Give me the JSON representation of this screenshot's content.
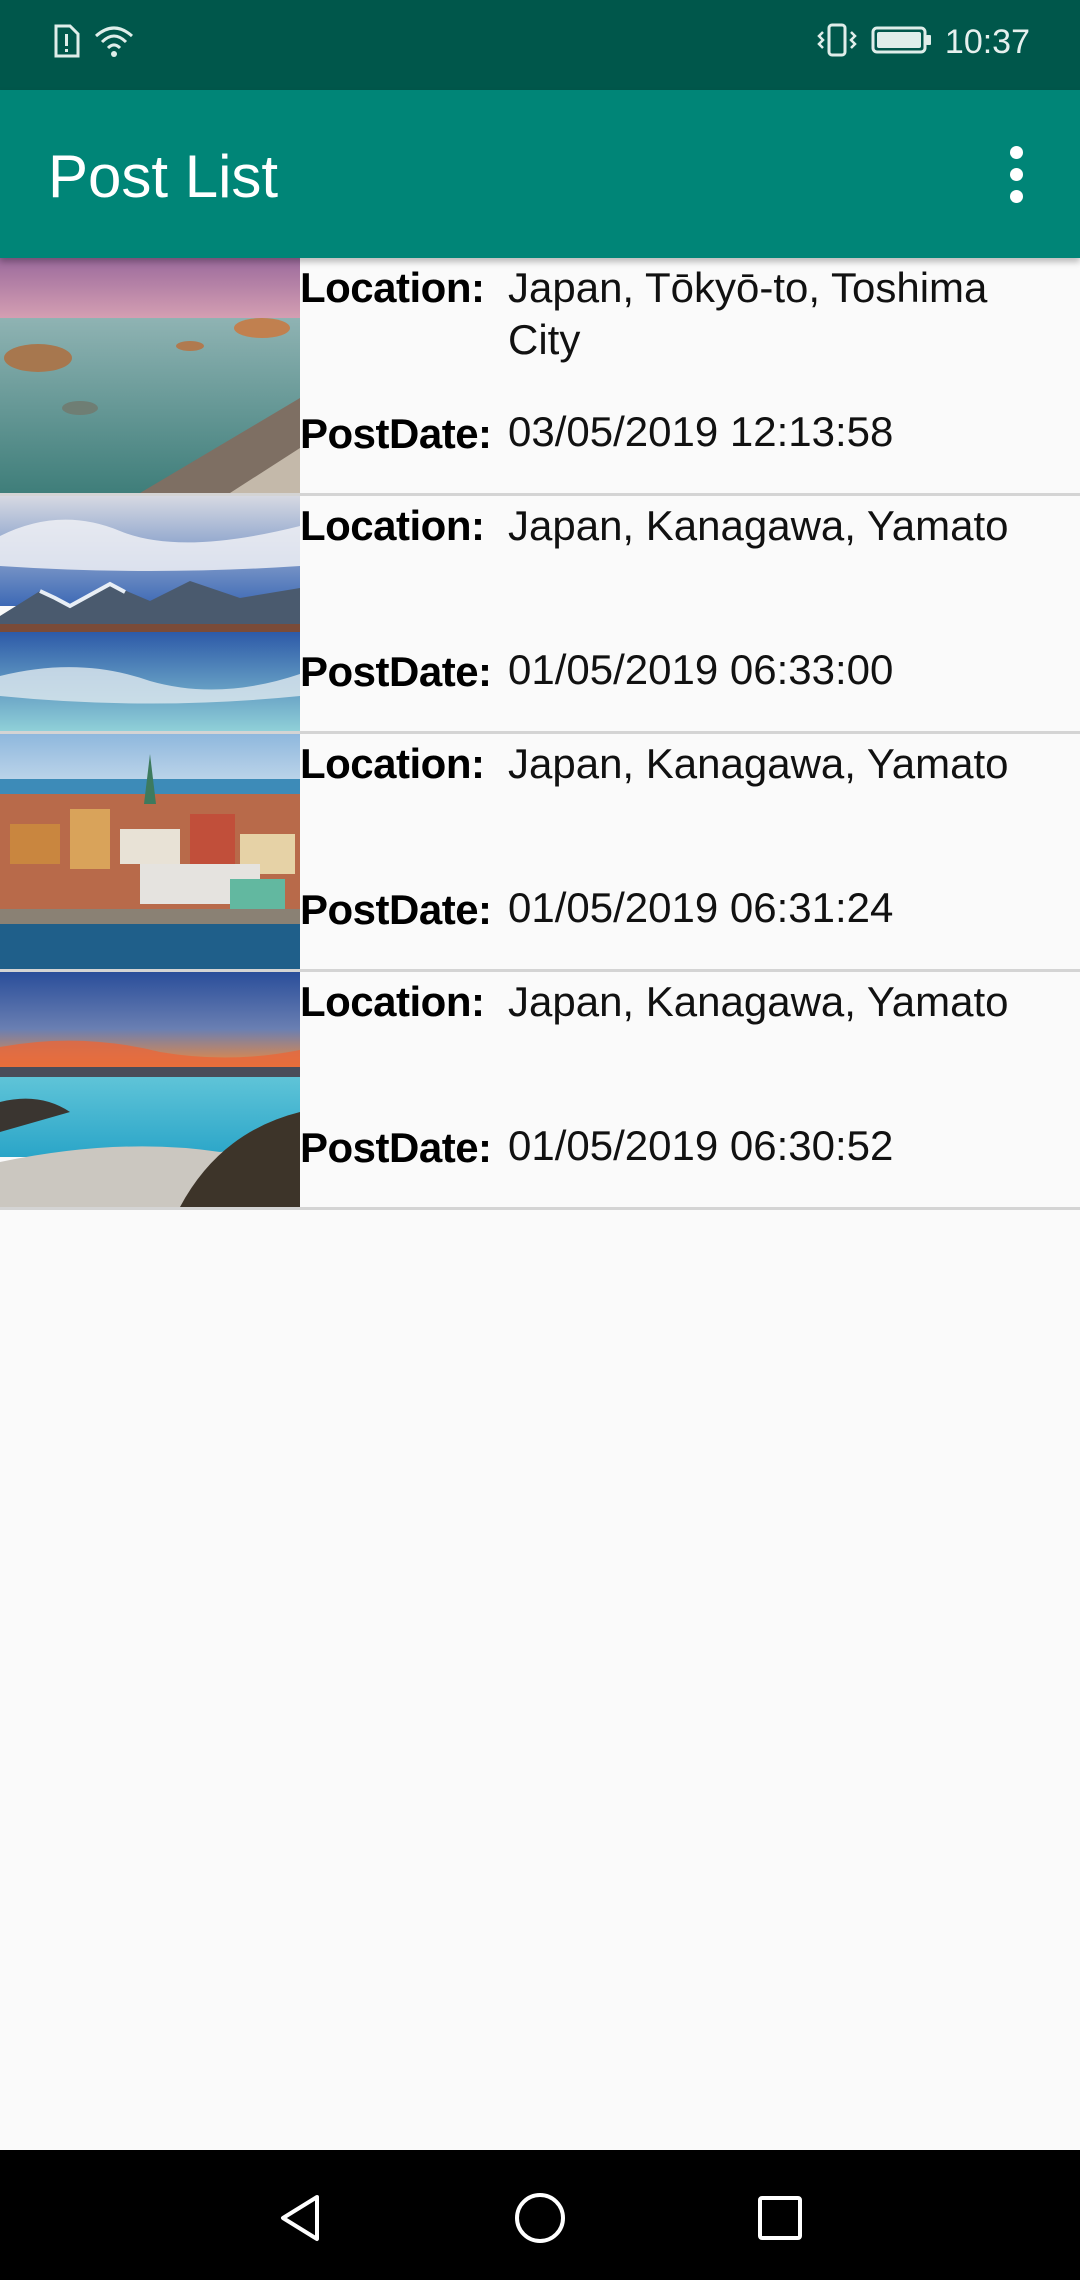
{
  "status_bar": {
    "time": "10:37",
    "icons": [
      "sim-alert-icon",
      "wifi-icon",
      "vibrate-icon",
      "battery-icon"
    ]
  },
  "app_bar": {
    "title": "Post List",
    "overflow_icon": "more-vert-icon"
  },
  "labels": {
    "location": "Location:",
    "post_date": "PostDate:"
  },
  "posts": [
    {
      "location": "Japan, Tōkyō-to, Toshima City",
      "post_date": "03/05/2019 12:13:58",
      "thumbnail": "rocky-coast-sunset"
    },
    {
      "location": "Japan, Kanagawa, Yamato",
      "post_date": "01/05/2019 06:33:00",
      "thumbnail": "mountain-lake-reflection"
    },
    {
      "location": "Japan, Kanagawa, Yamato",
      "post_date": "01/05/2019 06:31:24",
      "thumbnail": "waterfront-city"
    },
    {
      "location": "Japan, Kanagawa, Yamato",
      "post_date": "01/05/2019 06:30:52",
      "thumbnail": "blue-lagoon-dusk"
    }
  ],
  "nav_bar": {
    "buttons": [
      "back-icon",
      "home-icon",
      "recents-icon"
    ]
  },
  "colors": {
    "status_bar": "#00574b",
    "app_bar": "#008577",
    "background": "#fafafa",
    "divider": "#d4d4d4"
  }
}
